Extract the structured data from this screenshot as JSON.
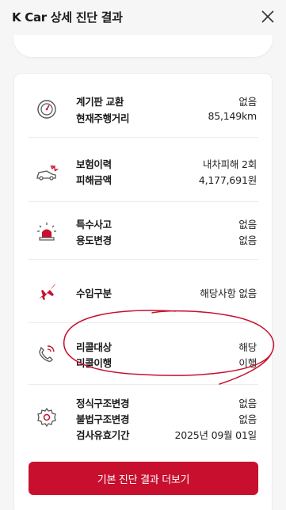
{
  "header": {
    "title": "K Car 상세 진단 결과"
  },
  "sections": [
    {
      "icon": "gauge-icon",
      "rows": [
        {
          "label": "계기판 교환",
          "value": "없음"
        },
        {
          "label": "현재주행거리",
          "value": "85,149km"
        }
      ]
    },
    {
      "icon": "car-crash-icon",
      "rows": [
        {
          "label": "보험이력",
          "value": "내차피해 2회"
        },
        {
          "label": "피해금액",
          "value": "4,177,691원"
        }
      ]
    },
    {
      "icon": "siren-icon",
      "rows": [
        {
          "label": "특수사고",
          "value": "없음"
        },
        {
          "label": "용도변경",
          "value": "없음"
        }
      ]
    },
    {
      "icon": "airplane-icon",
      "rows": [
        {
          "label": "수입구분",
          "value": "해당사항 없음"
        }
      ]
    },
    {
      "icon": "recall-phone-icon",
      "rows": [
        {
          "label": "리콜대상",
          "value": "해당"
        },
        {
          "label": "리콜이행",
          "value": "이행"
        }
      ]
    },
    {
      "icon": "gear-icon",
      "rows": [
        {
          "label": "정식구조변경",
          "value": "없음"
        },
        {
          "label": "불법구조변경",
          "value": "없음"
        },
        {
          "label": "검사유효기간",
          "value": "2025년 09월 01일"
        }
      ]
    }
  ],
  "cta": {
    "label": "기본 진단 결과 더보기"
  },
  "colors": {
    "accent": "#c8102e",
    "icon_gray": "#555555"
  }
}
